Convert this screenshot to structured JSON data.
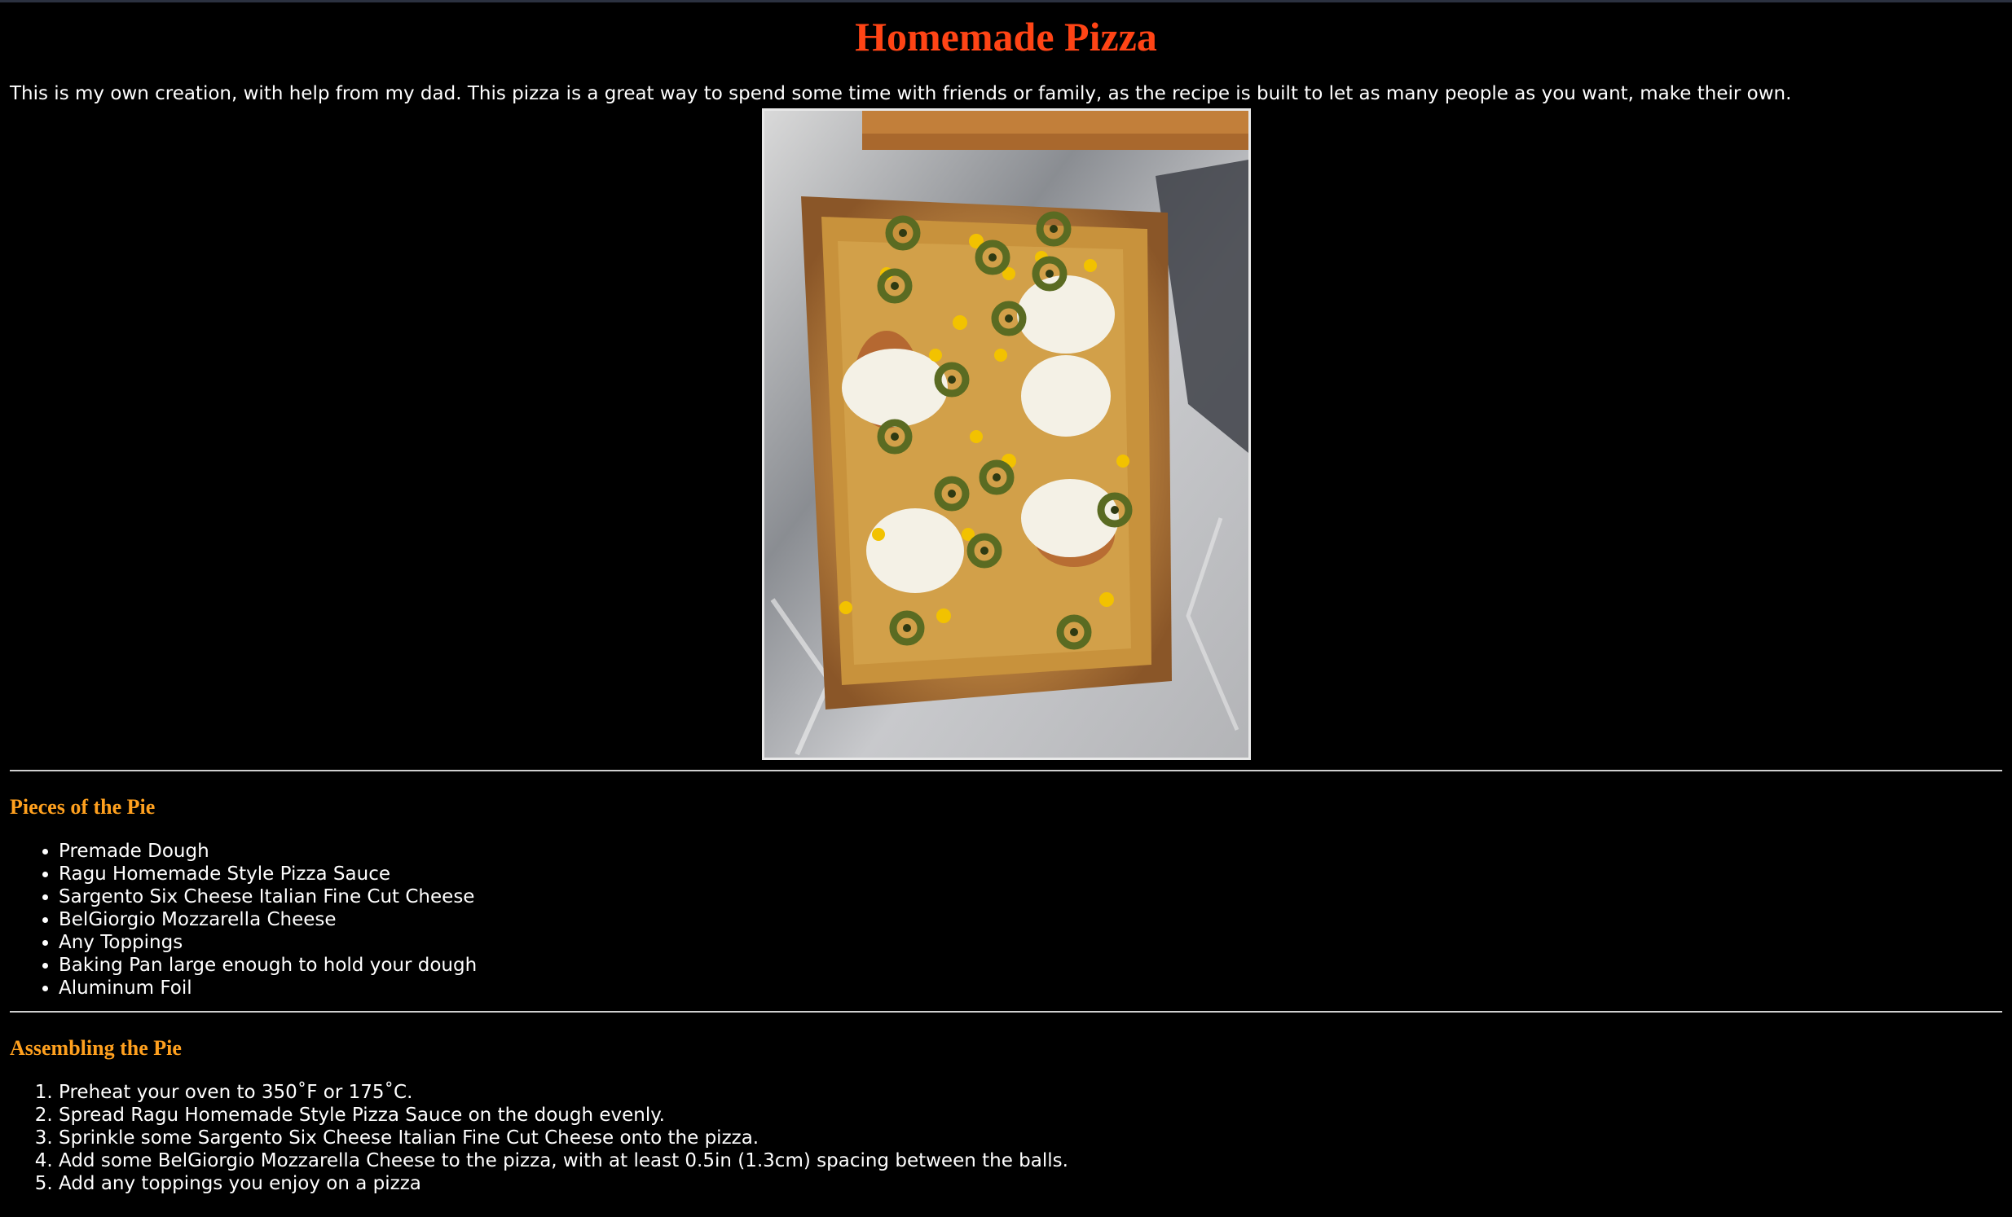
{
  "title": "Homemade Pizza",
  "intro": "This is my own creation, with help from my dad. This pizza is a great way to spend some time with friends or family, as the recipe is built to let as many people as you want, make their own.",
  "image_alt": "Homemade pizza",
  "ingredients": {
    "heading": "Pieces of the Pie",
    "items": [
      "Premade Dough",
      "Ragu Homemade Style Pizza Sauce",
      "Sargento Six Cheese Italian Fine Cut Cheese",
      "BelGiorgio Mozzarella Cheese",
      "Any Toppings",
      "Baking Pan large enough to hold your dough",
      "Aluminum Foil"
    ]
  },
  "steps": {
    "heading": "Assembling the Pie",
    "items": [
      "Preheat your oven to 350˚F or 175˚C.",
      "Spread Ragu Homemade Style Pizza Sauce on the dough evenly.",
      "Sprinkle some Sargento Six Cheese Italian Fine Cut Cheese onto the pizza.",
      "Add some BelGiorgio Mozzarella Cheese to the pizza, with at least 0.5in (1.3cm) spacing between the balls.",
      "Add any toppings you enjoy on a pizza"
    ]
  },
  "colors": {
    "background": "#000000",
    "title": "#ff4415",
    "section_heading": "#ffa01e",
    "text": "#ffffff"
  }
}
